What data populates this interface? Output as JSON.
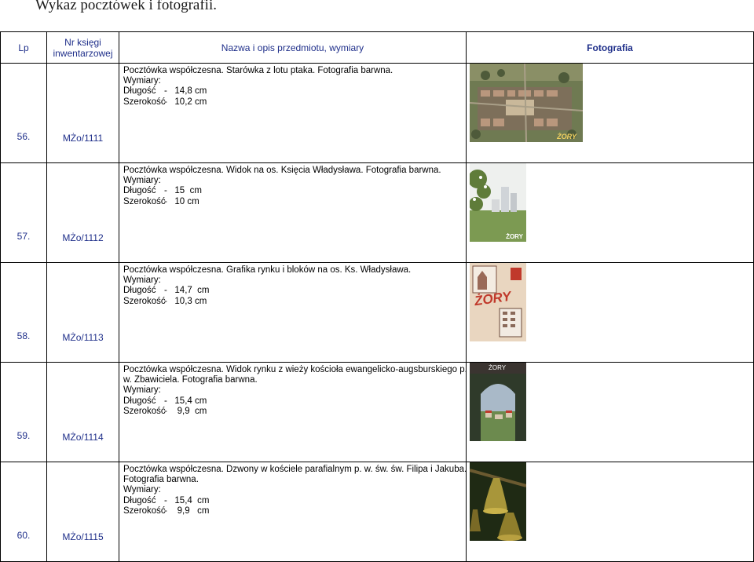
{
  "document": {
    "title": "Wykaz pocztówek i fotografii."
  },
  "table": {
    "headers": {
      "lp": "Lp",
      "nr": "Nr księgi inwentarzowej",
      "desc": "Nazwa i opis przedmiotu, wymiary",
      "photo": "Fotografia"
    },
    "rows": [
      {
        "lp": "56.",
        "nr": "MŻo/1111",
        "lines": [
          "Pocztówka współczesna. Starówka z lotu ptaka. Fotografia barwna."
        ],
        "wymiary": "Wymiary:",
        "dlugosc_label": "Długość",
        "dlugosc_value": "-   14,8 cm",
        "szerokosc_label": "Szerokość",
        "szerokosc_value": "-   10,2 cm",
        "photo_label": "ŻORY"
      },
      {
        "lp": "57.",
        "nr": "MŻo/1112",
        "lines": [
          "Pocztówka współczesna. Widok na os. Księcia Władysława. Fotografia barwna."
        ],
        "wymiary": "Wymiary:",
        "dlugosc_label": "Długość",
        "dlugosc_value": "-   15  cm",
        "szerokosc_label": "Szerokość",
        "szerokosc_value": "-   10 cm",
        "photo_label": "ŻORY"
      },
      {
        "lp": "58.",
        "nr": "MŻo/1113",
        "lines": [
          "Pocztówka współczesna. Grafika rynku i bloków na os. Ks. Władysława."
        ],
        "wymiary": "Wymiary:",
        "dlugosc_label": "Długość",
        "dlugosc_value": "-   14,7  cm",
        "szerokosc_label": "Szerokość",
        "szerokosc_value": "-   10,3 cm",
        "photo_label": "ŻORY"
      },
      {
        "lp": "59.",
        "nr": "MŻo/1114",
        "lines": [
          "Pocztówka współczesna. Widok rynku z wieży kościoła ewangelicko-augsburskiego p.",
          "w. Zbawiciela. Fotografia barwna."
        ],
        "wymiary": "Wymiary:",
        "dlugosc_label": "Długość",
        "dlugosc_value": "-   15,4 cm",
        "szerokosc_label": "Szerokość",
        "szerokosc_value": "-    9,9  cm",
        "photo_label": "ŻORY"
      },
      {
        "lp": "60.",
        "nr": "MŻo/1115",
        "lines": [
          "Pocztówka współczesna. Dzwony w kościele parafialnym p. w. św. św. Filipa i Jakuba.",
          "Fotografia barwna."
        ],
        "wymiary": "Wymiary:",
        "dlugosc_label": "Długość",
        "dlugosc_value": "-   15,4  cm",
        "szerokosc_label": "Szerokość",
        "szerokosc_value": "-    9,9   cm",
        "photo_label": ""
      }
    ]
  },
  "colors": {
    "header_text": "#1f2f8a",
    "accent_red": "#c0392b"
  }
}
